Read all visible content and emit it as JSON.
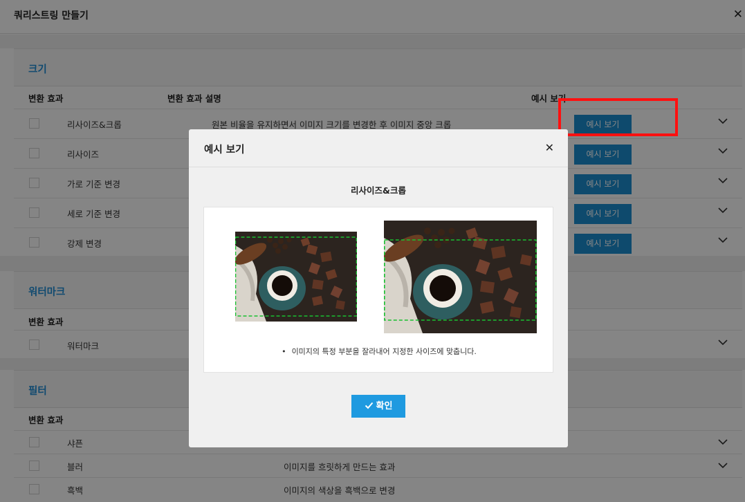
{
  "window": {
    "title": "쿼리스트링 만들기",
    "close_symbol": "✕"
  },
  "sections": {
    "size": {
      "title": "크기",
      "col_effect": "변환 효과",
      "col_desc": "변환 효과 설명",
      "col_example": "예시 보기",
      "rows": [
        {
          "name": "리사이즈&크롭",
          "desc": "원본 비율을 유지하면서 이미지 크기를 변경한 후 이미지 중앙 크롭",
          "button": "예시 보기"
        },
        {
          "name": "리사이즈",
          "desc": "",
          "button": "예시 보기"
        },
        {
          "name": "가로 기준 변경",
          "desc": "",
          "button": "예시 보기"
        },
        {
          "name": "세로 기준 변경",
          "desc": "",
          "button": "예시 보기"
        },
        {
          "name": "강제 변경",
          "desc": "",
          "button": "예시 보기"
        }
      ]
    },
    "watermark": {
      "title": "워터마크",
      "col_effect": "변환 효과",
      "rows": [
        {
          "name": "워터마크"
        }
      ]
    },
    "filter": {
      "title": "필터",
      "col_effect": "변환 효과",
      "rows": [
        {
          "name": "샤픈",
          "desc": ""
        },
        {
          "name": "블러",
          "desc": "이미지를 흐릿하게 만드는 효과"
        },
        {
          "name": "흑백",
          "desc": "이미지의 색상을 흑백으로 변경"
        }
      ]
    }
  },
  "modal": {
    "title": "예시 보기",
    "close_symbol": "✕",
    "subtitle": "리사이즈&크롭",
    "note": "이미지의 특정 부분을 잘라내어 지정한 사이즈에 맞춥니다.",
    "confirm_label": "확인"
  },
  "colors": {
    "accent": "#1b8fd2",
    "highlight": "#ff1010",
    "crop_guide": "#18c030"
  }
}
